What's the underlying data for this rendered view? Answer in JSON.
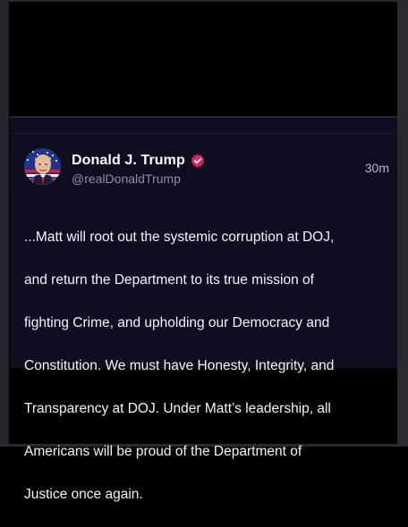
{
  "post": {
    "author": {
      "display_name": "Donald J. Trump",
      "handle": "@realDonaldTrump",
      "verified": true,
      "avatar_icon": "avatar-flag-portrait",
      "verified_icon": "verified-badge-icon",
      "verified_color": "#e0245e"
    },
    "timestamp": "30m",
    "body_lines": [
      "...Matt will root out the systemic corruption at DOJ,",
      "and return the Department to its true mission of",
      "fighting Crime, and upholding our Democracy and",
      "Constitution. We must have Honesty, Integrity, and",
      "Transparency at DOJ. Under Matt’s leadership, all",
      "Americans will be proud of the Department of",
      "Justice once again."
    ]
  },
  "colors": {
    "page_background": "#000000",
    "card_background": "#0f0e21",
    "name_text": "#ffffff",
    "handle_text": "#8e90a4",
    "body_text": "#f4f4f7"
  }
}
